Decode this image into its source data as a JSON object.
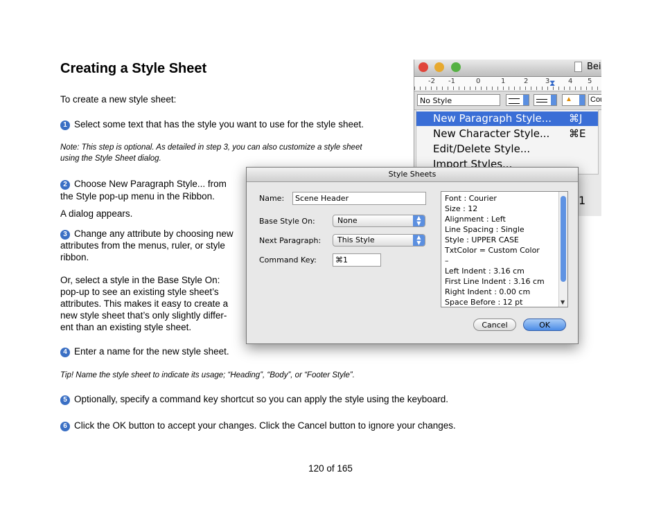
{
  "title": "Creating a Style Sheet",
  "intro": "To create a new style sheet:",
  "steps": [
    {
      "n": "1",
      "text": "Select some text that has the style you want to use for the style sheet."
    },
    {
      "n": "2",
      "line1": "Choose New Paragraph Style... from",
      "line2": "the Style pop-up menu in the Ribbon."
    },
    {
      "n": "3",
      "line1": "Change any attribute by choosing new",
      "line2": "attributes from the menus, ruler, or style",
      "line3": "ribbon."
    },
    {
      "n": "4",
      "text": "Enter a name for the new style sheet."
    },
    {
      "n": "5",
      "text": "Optionally, specify a command key shortcut so you can apply the style using the keyboard."
    },
    {
      "n": "6",
      "text": "Click the OK button to accept your changes. Click the Cancel button to ignore your changes."
    }
  ],
  "note_line1": "Note: This step is optional. As detailed in step 3, you can also customize a style sheet",
  "note_line2": "using the Style Sheet dialog.",
  "dialog_appears": "A dialog appears.",
  "or_para": [
    "Or, select a style in the Base Style On:",
    "pop-up to see an existing style sheet’s",
    "attributes. This makes it easy to create a",
    "new style sheet that’s only slightly differ-",
    "ent than an existing style sheet."
  ],
  "tip": "Tip! Name the style sheet to indicate its usage; “Heading”, “Body”, or “Footer Style”.",
  "page": "120 of 165",
  "app_window": {
    "title_fragment": "Bei",
    "ruler_numbers": [
      "-2",
      "-1",
      "0",
      "1",
      "2",
      "3",
      "4",
      "5"
    ],
    "style_popup": "No Style",
    "font_fragment": "Cou",
    "menu": [
      {
        "label": "New Paragraph Style...",
        "key": "⌘J",
        "highlighted": true
      },
      {
        "label": "New Character Style...",
        "key": "⌘E",
        "highlighted": false
      },
      {
        "label": "Edit/Delete Style...",
        "key": "",
        "highlighted": false
      },
      {
        "label": "Import Styles...",
        "key": "",
        "highlighted": false
      }
    ],
    "side_number": "1"
  },
  "dialog": {
    "title": "Style Sheets",
    "name_label": "Name:",
    "name_value": "Scene Header",
    "base_label": "Base Style On:",
    "base_value": "None",
    "next_label": "Next Paragraph:",
    "next_value": "This Style",
    "cmd_label": "Command Key:",
    "cmd_value": "⌘1",
    "attributes": [
      "Font : Courier",
      "Size : 12",
      "Alignment : Left",
      "Line Spacing : Single",
      "Style : UPPER CASE",
      "TxtColor = Custom Color",
      "–",
      "Left Indent : 3.16 cm",
      "First Line Indent : 3.16 cm",
      "Right Indent : 0.00 cm",
      "Space Before : 12 pt"
    ],
    "cancel": "Cancel",
    "ok": "OK"
  },
  "colors": {
    "step_badge": "#3a6fc4",
    "menu_highlight": "#3a6ed6",
    "ok_button": "#4b8ce6"
  }
}
